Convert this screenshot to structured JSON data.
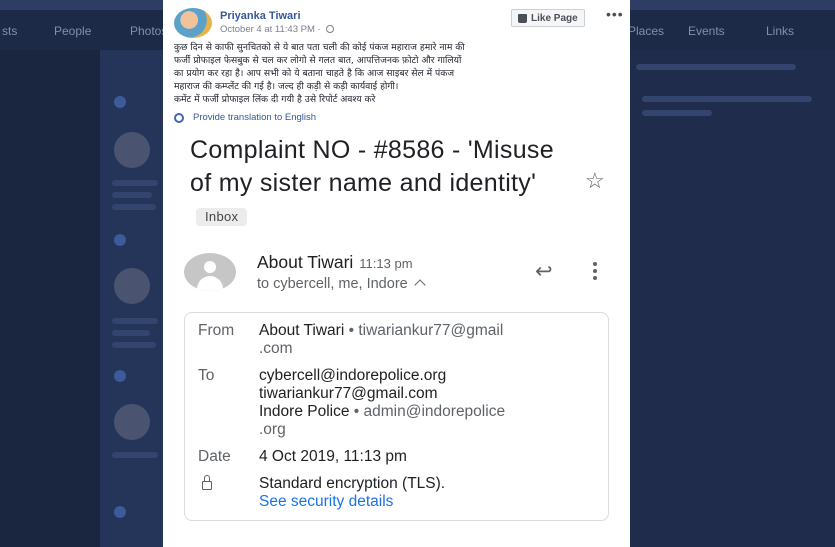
{
  "background": {
    "nav_items": [
      "sts",
      "People",
      "Photos",
      "Places",
      "Events",
      "Links"
    ]
  },
  "post": {
    "author": "Priyanka Tiwari",
    "timestamp": "October 4 at 11:43 PM · ",
    "like_button": "Like Page",
    "more_label": "•••",
    "text_lines": [
      "कुछ दिन से काफी सुनचितको से ये बात पता चली की कोई पंकज महाराज हमारे नाम की",
      "फर्जी प्रोफाइल फेसबुक से चल कर लोगो से गलत बात, आपत्तिजनक फ़ोटो और गालियों",
      "का प्रयोग कर रहा है। आप सभी को ये बताना चाहते है कि आज साइबर सेल में पंकज",
      "महाराज की कम्प्लेंट की गई है। जल्द ही कड़ी से कड़ी कार्यवाई होगी।",
      "कमेंट में फर्जी प्रोफाइल लिंक दी गयी है उसे रिपोर्ट अवश्य करे"
    ],
    "translate_label": "Provide translation to English"
  },
  "email": {
    "subject": "Complaint NO - #8586 - 'Misuse of my sister name and identity'",
    "inbox_badge": "Inbox",
    "sender_name": "About Tiwari",
    "sender_time": "11:13 pm",
    "recipients": "to cybercell, me, Indore",
    "from_label": "From",
    "from_name": "About Tiwari",
    "from_email_1": "• tiwariankur77@gmail",
    "from_email_2": ".com",
    "to_label": "To",
    "to_line_1": "cybercell@indorepolice.org",
    "to_line_2": "tiwariankur77@gmail.com",
    "to_name_3": "Indore Police",
    "to_email_3": " • admin@indorepolice",
    "to_line_4": ".org",
    "date_label": "Date",
    "date_value": "4 Oct 2019, 11:13 pm",
    "security_value": "Standard encryption (TLS).",
    "security_link": "See security details"
  }
}
